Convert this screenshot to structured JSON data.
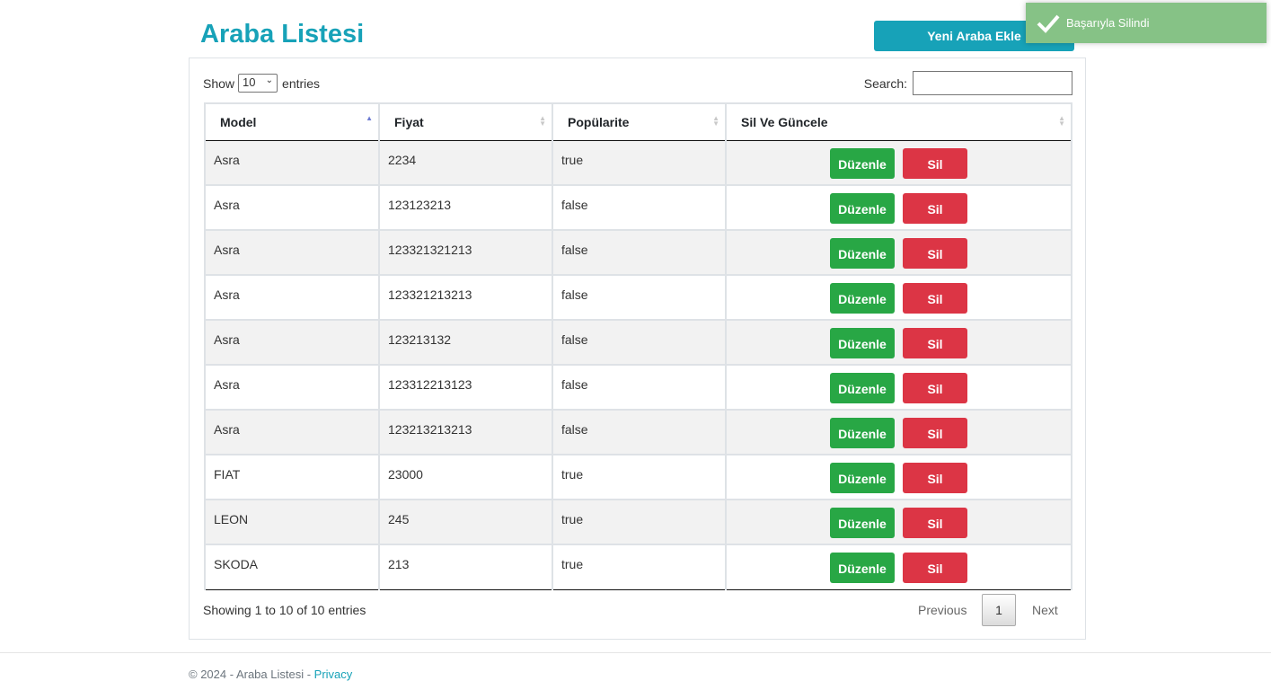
{
  "page": {
    "title": "Araba Listesi",
    "add_button": "Yeni Araba Ekle"
  },
  "toast": {
    "message": "Başarıyla Silindi",
    "icon": "check-icon",
    "color": "#86c286"
  },
  "controls": {
    "show_label": "Show",
    "length_value": "10",
    "entries_label": "entries",
    "search_label": "Search:",
    "search_value": ""
  },
  "table": {
    "columns": [
      "Model",
      "Fiyat",
      "Popülarite",
      "Sil Ve Güncele"
    ],
    "edit_label": "Düzenle",
    "delete_label": "Sil",
    "rows": [
      {
        "model": "Asra",
        "price": "2234",
        "popular": "true"
      },
      {
        "model": "Asra",
        "price": "123123213",
        "popular": "false"
      },
      {
        "model": "Asra",
        "price": "123321321213",
        "popular": "false"
      },
      {
        "model": "Asra",
        "price": "123321213213",
        "popular": "false"
      },
      {
        "model": "Asra",
        "price": "123213132",
        "popular": "false"
      },
      {
        "model": "Asra",
        "price": "123312213123",
        "popular": "false"
      },
      {
        "model": "Asra",
        "price": "123213213213",
        "popular": "false"
      },
      {
        "model": "FIAT",
        "price": "23000",
        "popular": "true"
      },
      {
        "model": "LEON",
        "price": "245",
        "popular": "true"
      },
      {
        "model": "SKODA",
        "price": "213",
        "popular": "true"
      }
    ]
  },
  "pagination": {
    "info": "Showing 1 to 10 of 10 entries",
    "previous": "Previous",
    "current_page": "1",
    "next": "Next"
  },
  "footer": {
    "text": "© 2024 - Araba Listesi - ",
    "link": "Privacy"
  },
  "colors": {
    "accent": "#17a2b8",
    "edit": "#28a745",
    "delete": "#dc3545"
  }
}
